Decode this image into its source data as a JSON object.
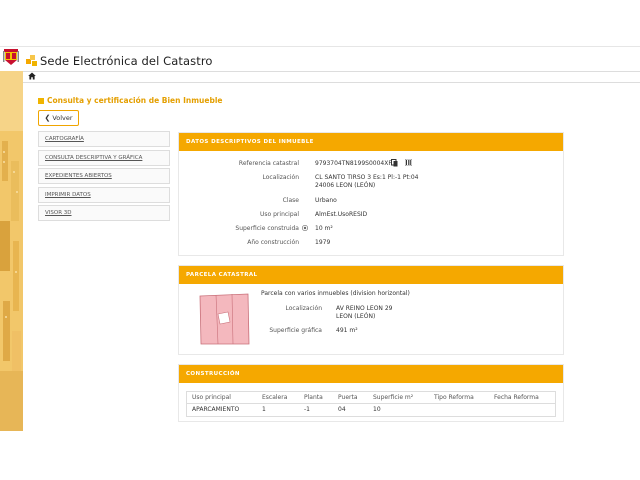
{
  "header": {
    "site_title": "Sede Electrónica del Catastro"
  },
  "page": {
    "title": "Consulta y certificación de Bien Inmueble",
    "back_label": "Volver"
  },
  "sidebar": {
    "items": [
      {
        "label": "CARTOGRAFÍA"
      },
      {
        "label": "CONSULTA DESCRIPTIVA Y GRÁFICA"
      },
      {
        "label": "EXPEDIENTES ABIERTOS"
      },
      {
        "label": "IMPRIMIR DATOS"
      },
      {
        "label": "VISOR 3D"
      }
    ]
  },
  "datos": {
    "title": "DATOS DESCRIPTIVOS DEL INMUEBLE",
    "rows": [
      {
        "label": "Referencia catastral",
        "value": "9793704TN8199S0004XF"
      },
      {
        "label": "Localización",
        "value": "CL SANTO TIRSO 3 Es:1 Pl:-1 Pt:04",
        "value2": "24006 LEON (LEÓN)"
      },
      {
        "label": "Clase",
        "value": "Urbano"
      },
      {
        "label": "Uso principal",
        "value": "AlmEst.UsoRESID"
      },
      {
        "label": "Superficie construida",
        "value": "10 m²"
      },
      {
        "label": "Año construcción",
        "value": "1979"
      }
    ]
  },
  "parcela": {
    "title": "PARCELA CATASTRAL",
    "subtitle": "Parcela con varios inmuebles (division horizontal)",
    "loc_label": "Localización",
    "loc_value": "AV REINO LEON 29",
    "loc_value2": "LEON (LEÓN)",
    "sup_label": "Superficie gráfica",
    "sup_value": "491 m²"
  },
  "construccion": {
    "title": "CONSTRUCCIÓN",
    "headers": [
      "Uso principal",
      "Escalera",
      "Planta",
      "Puerta",
      "Superficie m²",
      "Tipo Reforma",
      "Fecha Reforma"
    ],
    "rows": [
      [
        "APARCAMIENTO",
        "1",
        "-1",
        "04",
        "10",
        "",
        ""
      ]
    ]
  },
  "colors": {
    "accent": "#f5a800",
    "title": "#e49f00",
    "parcel_fill": "#f4b8be"
  },
  "icons": [
    "shield-icon",
    "catastro-logo-icon",
    "home-icon",
    "chevron-left-icon",
    "copy-icon",
    "barcode-icon",
    "info-icon"
  ]
}
